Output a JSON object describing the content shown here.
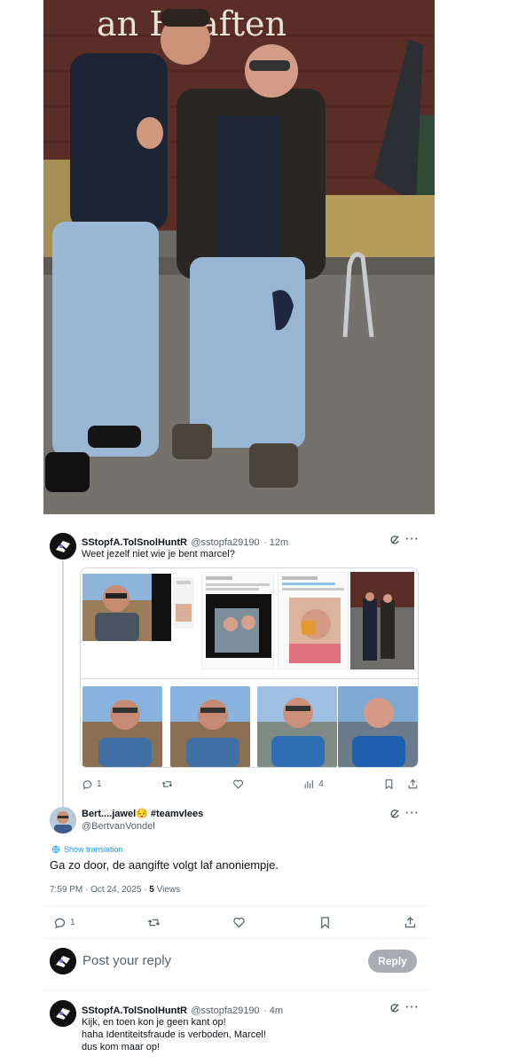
{
  "photo": {
    "sign_text": "an Haaften",
    "description_icon": "photo"
  },
  "reply1": {
    "display_name": "SStopfA.TolSnolHuntR",
    "handle": "@sstopfa29190",
    "time": "· 12m",
    "text": "Weet jezelf niet wie je bent marcel?",
    "actions": {
      "replies": "1",
      "retweets": "",
      "likes": "",
      "views": "4"
    }
  },
  "main_tweet": {
    "display_name": "Bert....jawel😔 #teamvlees",
    "handle": "@BertvanVondel",
    "translate_label": "Show translation",
    "text": "Ga zo door, de aangifte volgt laf anoniempje.",
    "timestamp": "7:59 PM · Oct 24, 2025 · ",
    "views_count": "5",
    "views_label": " Views",
    "actions": {
      "replies": "1"
    }
  },
  "compose": {
    "placeholder": "Post your reply",
    "button_label": "Reply"
  },
  "reply2": {
    "display_name": "SStopfA.TolSnolHuntR",
    "handle": "@sstopfa29190",
    "time": "· 4m",
    "lines": [
      "Kijk, en toen kon je geen kant op!",
      "haha Identiteitsfraude is verboden, Marcel!",
      "dus kom maar op!"
    ]
  },
  "colors": {
    "accent": "#1d9bf0",
    "muted": "#536471",
    "reply_button": "#a7adb2"
  }
}
